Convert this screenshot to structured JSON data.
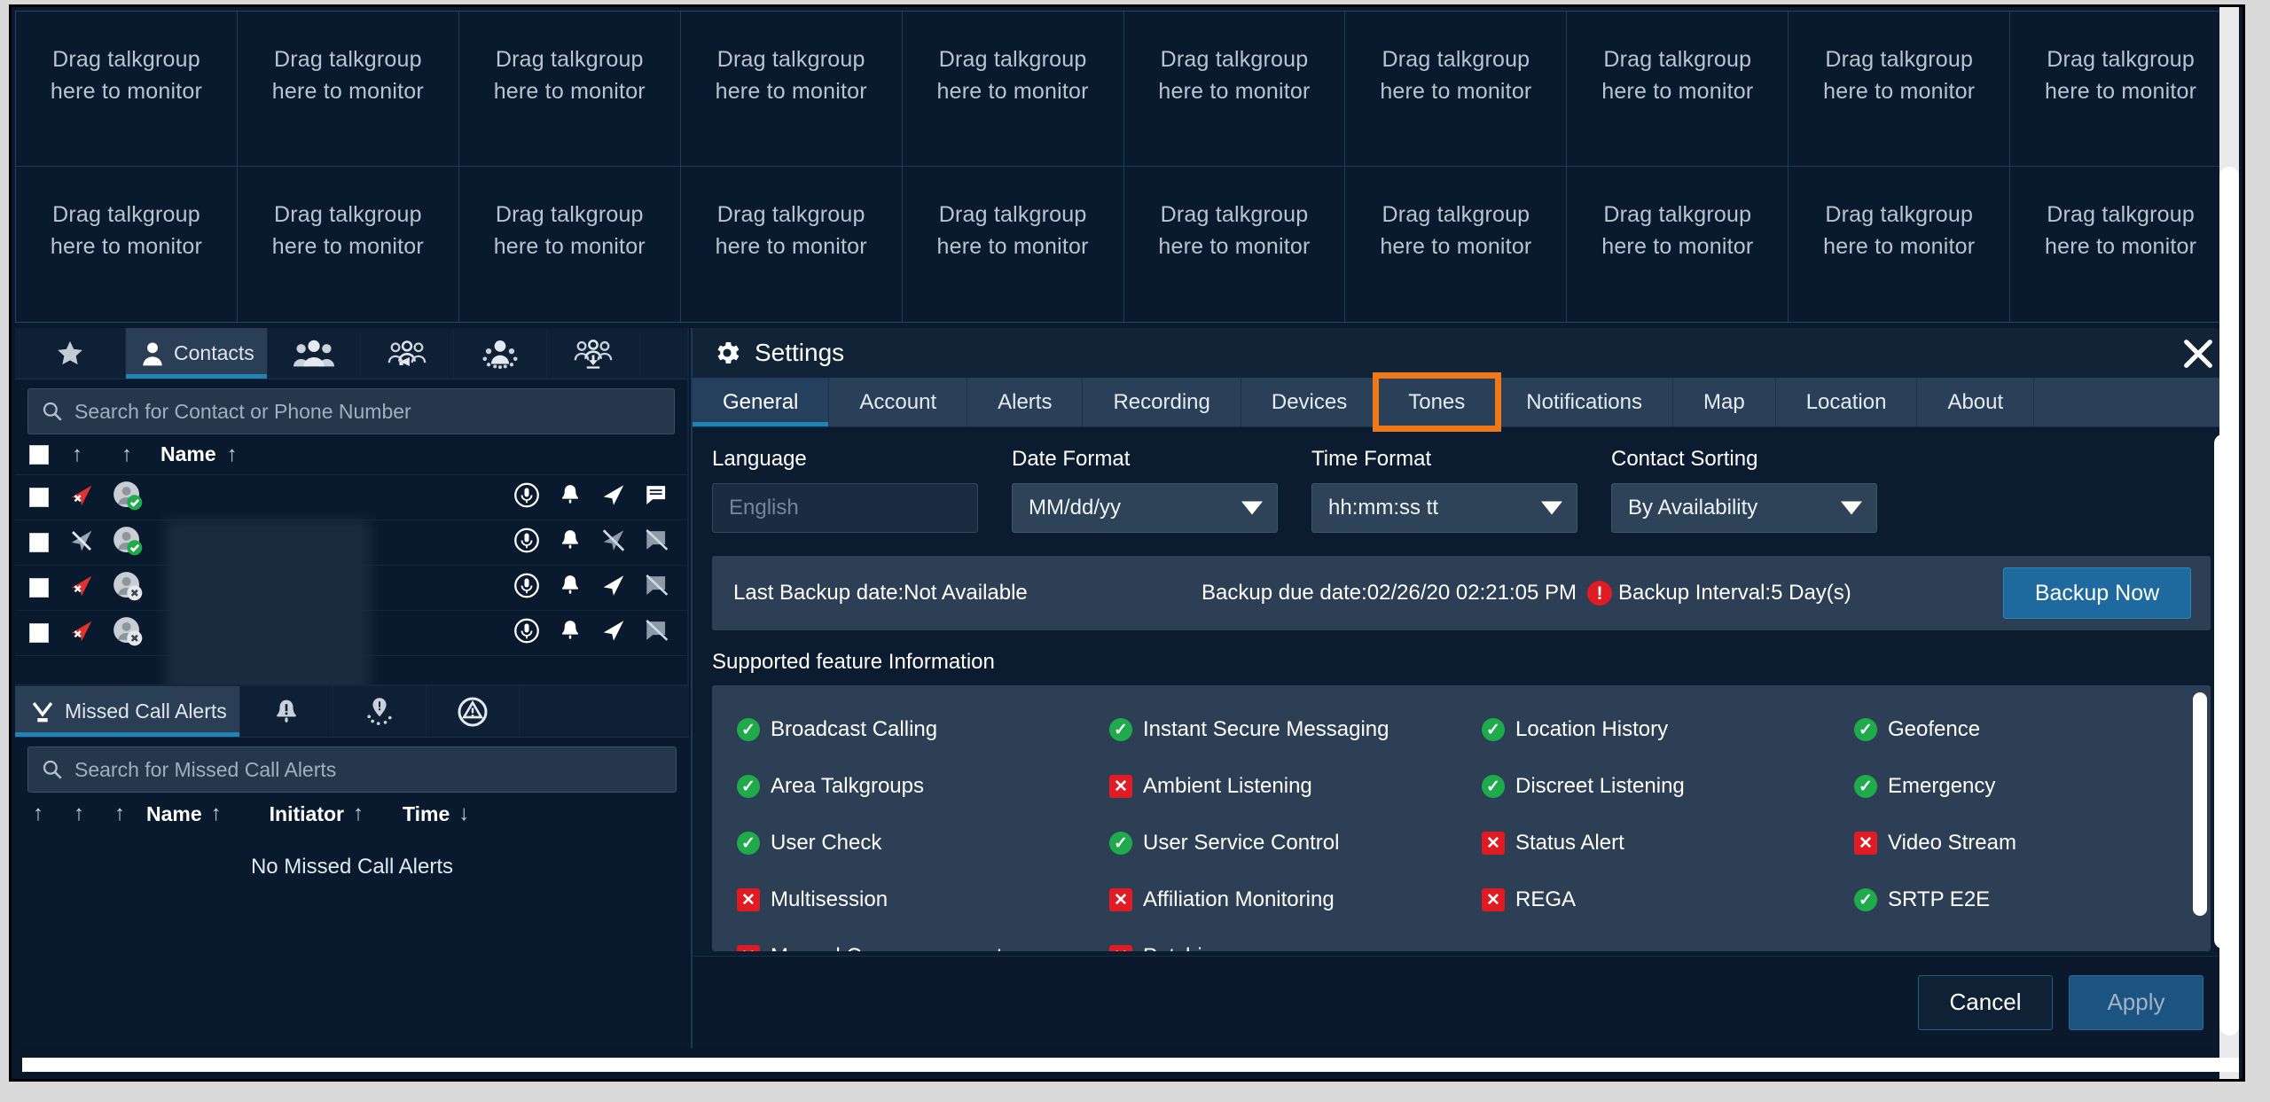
{
  "talkgroups": {
    "placeholder_line1": "Drag talkgroup",
    "placeholder_line2": "here to monitor",
    "columns": 10,
    "rows": 2
  },
  "contacts_panel": {
    "tabs": [
      {
        "label": "",
        "icon": "star-icon",
        "active": false
      },
      {
        "label": "Contacts",
        "icon": "person-icon",
        "active": true
      },
      {
        "label": "",
        "icon": "group-icon",
        "active": false
      },
      {
        "label": "",
        "icon": "talkgroup-broadcast-icon",
        "active": false
      },
      {
        "label": "",
        "icon": "area-talkgroup-icon",
        "active": false
      },
      {
        "label": "",
        "icon": "group-download-icon",
        "active": false
      }
    ],
    "search_placeholder": "Search for Contact or Phone Number",
    "columns": {
      "name": "Name"
    },
    "rows": [
      {
        "name": "",
        "loc": "loc-on",
        "avatar": "avail",
        "icons": [
          "mic-icon",
          "bell-icon",
          "loc-on-icon",
          "message-icon"
        ]
      },
      {
        "name": "",
        "loc": "loc-off",
        "avatar": "avail",
        "icons": [
          "mic-icon",
          "bell-icon",
          "loc-off-icon",
          "message-off-icon"
        ]
      },
      {
        "name": "",
        "loc": "loc-on",
        "avatar": "unavail",
        "icons": [
          "mic-icon",
          "bell-icon",
          "loc-on-icon",
          "message-off-icon"
        ]
      },
      {
        "name": "",
        "loc": "loc-on",
        "avatar": "unavail",
        "icons": [
          "mic-icon",
          "bell-icon",
          "loc-on-icon",
          "message-off-icon"
        ]
      }
    ]
  },
  "missed_calls_panel": {
    "tabs": [
      {
        "label": "Missed Call Alerts",
        "icon": "missed-call-icon",
        "active": true
      },
      {
        "label": "",
        "icon": "alert-bell-icon",
        "active": false
      },
      {
        "label": "",
        "icon": "geofence-pin-icon",
        "active": false
      },
      {
        "label": "",
        "icon": "emergency-icon",
        "active": false
      }
    ],
    "search_placeholder": "Search for Missed Call Alerts",
    "columns": {
      "name": "Name",
      "initiator": "Initiator",
      "time": "Time"
    },
    "empty_text": "No Missed Call Alerts"
  },
  "settings": {
    "title": "Settings",
    "title_icon": "gear-icon",
    "close_icon": "close-icon",
    "tabs": [
      {
        "label": "General",
        "active": true,
        "highlighted": false
      },
      {
        "label": "Account",
        "active": false,
        "highlighted": false
      },
      {
        "label": "Alerts",
        "active": false,
        "highlighted": false
      },
      {
        "label": "Recording",
        "active": false,
        "highlighted": false
      },
      {
        "label": "Devices",
        "active": false,
        "highlighted": false
      },
      {
        "label": "Tones",
        "active": false,
        "highlighted": true
      },
      {
        "label": "Notifications",
        "active": false,
        "highlighted": false
      },
      {
        "label": "Map",
        "active": false,
        "highlighted": false
      },
      {
        "label": "Location",
        "active": false,
        "highlighted": false
      },
      {
        "label": "About",
        "active": false,
        "highlighted": false
      }
    ],
    "fields": {
      "language": {
        "label": "Language",
        "value": "English"
      },
      "date_format": {
        "label": "Date Format",
        "value": "MM/dd/yy"
      },
      "time_format": {
        "label": "Time Format",
        "value": "hh:mm:ss tt"
      },
      "contact_sorting": {
        "label": "Contact Sorting",
        "value": "By Availability"
      }
    },
    "backup": {
      "last_backup": "Last Backup date:Not Available",
      "due_date": "Backup due date:02/26/20 02:21:05 PM",
      "warning_glyph": "!",
      "interval": "Backup Interval:5 Day(s)",
      "button": "Backup Now"
    },
    "features": {
      "title": "Supported feature Information",
      "items": [
        {
          "label": "Broadcast Calling",
          "supported": true
        },
        {
          "label": "Instant Secure Messaging",
          "supported": true
        },
        {
          "label": "Location History",
          "supported": true
        },
        {
          "label": "Geofence",
          "supported": true
        },
        {
          "label": "Area Talkgroups",
          "supported": true
        },
        {
          "label": "Ambient Listening",
          "supported": false
        },
        {
          "label": "Discreet Listening",
          "supported": true
        },
        {
          "label": "Emergency",
          "supported": true
        },
        {
          "label": "User Check",
          "supported": true
        },
        {
          "label": "User Service Control",
          "supported": true
        },
        {
          "label": "Status Alert",
          "supported": false
        },
        {
          "label": "Video Stream",
          "supported": false
        },
        {
          "label": "Multisession",
          "supported": false
        },
        {
          "label": "Affiliation Monitoring",
          "supported": false
        },
        {
          "label": "REGA",
          "supported": false
        },
        {
          "label": "SRTP E2E",
          "supported": true
        },
        {
          "label": "Manual Commencement",
          "supported": false
        },
        {
          "label": "Patching",
          "supported": false
        }
      ]
    },
    "footer": {
      "cancel": "Cancel",
      "apply": "Apply"
    }
  },
  "colors": {
    "accent_blue": "#1f84b5",
    "highlight_orange": "#f07818",
    "ok_green": "#1faa4b",
    "no_red": "#e01b24",
    "panel_bg": "#0a1a2e",
    "primary_button": "#1e6a9e"
  }
}
